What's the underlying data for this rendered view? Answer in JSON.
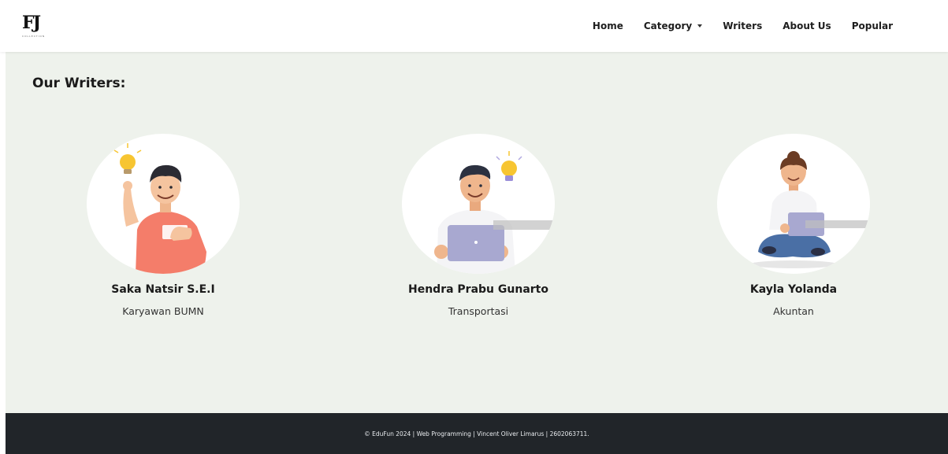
{
  "brand": {
    "logo_text": "FJ",
    "logo_subtext": "COLLECTION"
  },
  "nav": {
    "items": [
      {
        "label": "Home"
      },
      {
        "label": "Category"
      },
      {
        "label": "Writers"
      },
      {
        "label": "About Us"
      },
      {
        "label": "Popular"
      }
    ]
  },
  "page": {
    "section_title": "Our Writers:"
  },
  "writers": [
    {
      "name": "Saka Natsir S.E.I",
      "role": "Karyawan BUMN",
      "avatar_icon": "man-idea-thumbs-up-illustration"
    },
    {
      "name": "Hendra Prabu Gunarto",
      "role": "Transportasi",
      "avatar_icon": "man-laptop-idea-illustration"
    },
    {
      "name": "Kayla Yolanda",
      "role": "Akuntan",
      "avatar_icon": "woman-laptop-sitting-illustration"
    }
  ],
  "footer": {
    "text": "© EduFun 2024 | Web Programming | Vincent Oliver Limarus | 2602063711."
  },
  "colors": {
    "main_background": "#eef2ec",
    "footer_background": "#212529",
    "shirt_coral": "#f47d6a",
    "laptop_lavender": "#a8a8d0",
    "jeans_blue": "#4a6fa5",
    "bulb_yellow": "#f7c531"
  }
}
